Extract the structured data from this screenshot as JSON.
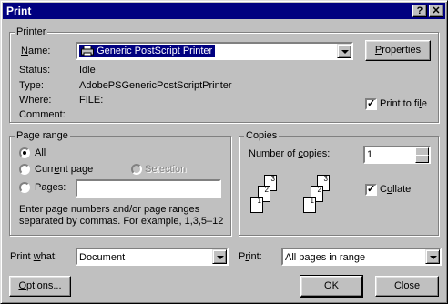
{
  "window": {
    "title": "Print",
    "help_btn": "?",
    "close_btn": "✕"
  },
  "printer": {
    "legend": "Printer",
    "name_label": "Name:",
    "name_value": "Generic PostScript Printer",
    "properties_label": "Properties",
    "status_label": "Status:",
    "status_value": "Idle",
    "type_label": "Type:",
    "type_value": "AdobePSGenericPostScriptPrinter",
    "where_label": "Where:",
    "where_value": "FILE:",
    "comment_label": "Comment:",
    "print_to_file_label": "Print to file",
    "print_to_file_checked": true
  },
  "page_range": {
    "legend": "Page range",
    "all_label": "All",
    "current_label": "Current page",
    "selection_label": "Selection",
    "pages_label": "Pages:",
    "pages_value": "",
    "help_text_1": "Enter page numbers and/or page ranges",
    "help_text_2": "separated by commas.  For example, 1,3,5–12",
    "selected": "all"
  },
  "copies": {
    "legend": "Copies",
    "number_label": "Number of copies:",
    "number_value": "1",
    "collate_label": "Collate",
    "collate_checked": true,
    "page_labels": [
      "3",
      "2",
      "1"
    ]
  },
  "print_what": {
    "label": "Print what:",
    "value": "Document"
  },
  "print": {
    "label": "Print:",
    "value": "All pages in range"
  },
  "buttons": {
    "options": "Options...",
    "ok": "OK",
    "close": "Close"
  }
}
